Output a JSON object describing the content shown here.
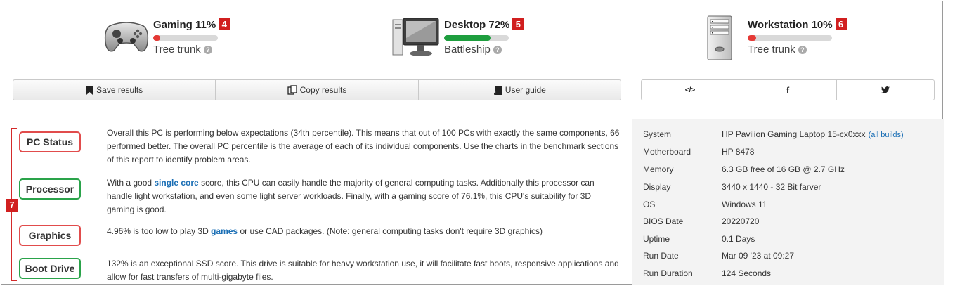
{
  "stats": [
    {
      "title": "Gaming 11%",
      "badge": "4",
      "sub": "Tree trunk",
      "percent": 11,
      "bar_color": "#e53935",
      "icon": "gamepad-icon"
    },
    {
      "title": "Desktop 72%",
      "badge": "5",
      "sub": "Battleship",
      "percent": 72,
      "bar_color": "#1e9e3e",
      "icon": "desktop-computer-icon"
    },
    {
      "title": "Workstation 10%",
      "badge": "6",
      "sub": "Tree trunk",
      "percent": 10,
      "bar_color": "#e53935",
      "icon": "tower-server-icon"
    }
  ],
  "toolbar": {
    "save": "Save results",
    "copy": "Copy results",
    "guide": "User guide"
  },
  "share": {
    "embed": "</>",
    "facebook": "f",
    "twitter": "🐦"
  },
  "section_badge": "7",
  "status": [
    {
      "label": "PC Status",
      "state": "red",
      "text": "Overall this PC is performing below expectations (34th percentile). This means that out of 100 PCs with exactly the same components, 66 performed better. The overall PC percentile is the average of each of its individual components. Use the charts in the benchmark sections of this report to identify problem areas."
    },
    {
      "label": "Processor",
      "state": "green",
      "pre": "With a good ",
      "link": "single core",
      "post": " score, this CPU can easily handle the majority of general computing tasks. Additionally this processor can handle light workstation, and even some light server workloads. Finally, with a gaming score of 76.1%, this CPU's suitability for 3D gaming is good."
    },
    {
      "label": "Graphics",
      "state": "red",
      "pre": "4.96% is too low to play 3D ",
      "link": "games",
      "post": " or use CAD packages. (Note: general computing tasks don't require 3D graphics)"
    },
    {
      "label": "Boot Drive",
      "state": "green",
      "text": "132% is an exceptional SSD score. This drive is suitable for heavy workstation use, it will facilitate fast boots, responsive applications and allow for fast transfers of multi-gigabyte files."
    }
  ],
  "system": {
    "all_builds": "(all builds)",
    "rows": [
      {
        "k": "System",
        "v": "HP Pavilion Gaming Laptop 15-cx0xxx"
      },
      {
        "k": "Motherboard",
        "v": "HP 8478"
      },
      {
        "k": "Memory",
        "v": "6.3 GB free of 16 GB @ 2.7 GHz"
      },
      {
        "k": "Display",
        "v": "3440 x 1440 - 32 Bit farver"
      },
      {
        "k": "OS",
        "v": "Windows 11"
      },
      {
        "k": "BIOS Date",
        "v": "20220720"
      },
      {
        "k": "Uptime",
        "v": "0.1 Days"
      },
      {
        "k": "Run Date",
        "v": "Mar 09 '23 at 09:27"
      },
      {
        "k": "Run Duration",
        "v": "124 Seconds"
      }
    ]
  }
}
